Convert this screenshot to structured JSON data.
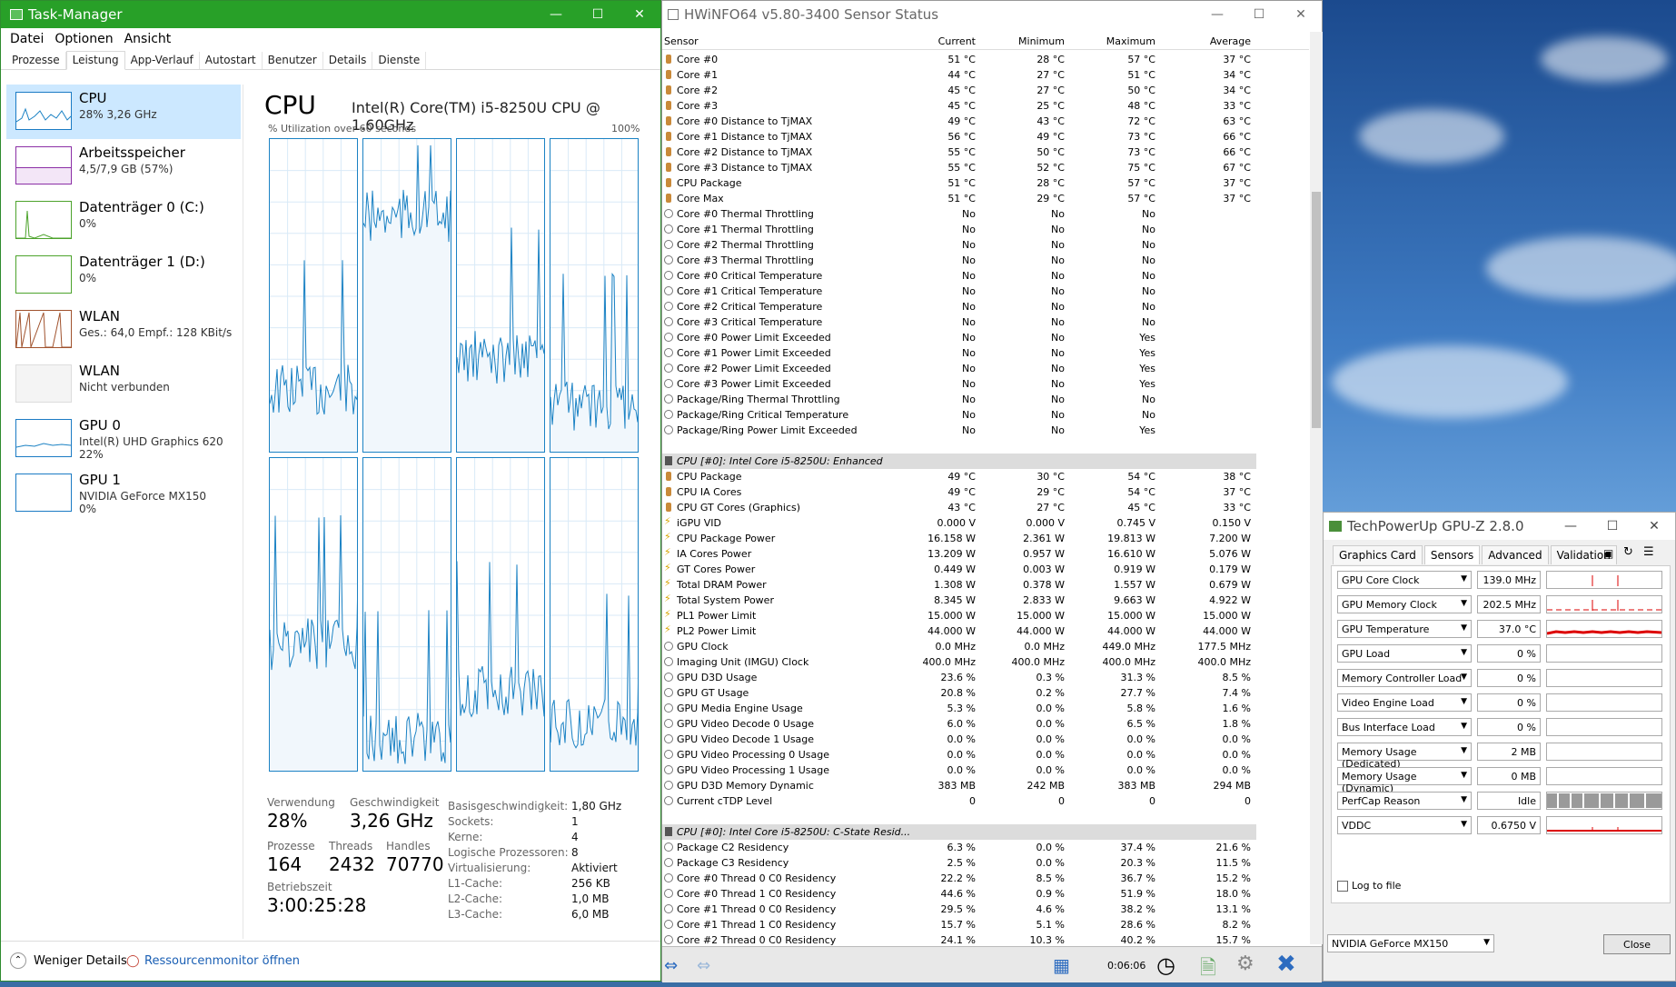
{
  "taskmanager": {
    "title": "Task-Manager",
    "menu": [
      "Datei",
      "Optionen",
      "Ansicht"
    ],
    "tabs": [
      "Prozesse",
      "Leistung",
      "App-Verlauf",
      "Autostart",
      "Benutzer",
      "Details",
      "Dienste"
    ],
    "sidebar": [
      {
        "t1": "CPU",
        "t2": "28% 3,26 GHz",
        "t3": ""
      },
      {
        "t1": "Arbeitsspeicher",
        "t2": "4,5/7,9 GB (57%)",
        "t3": ""
      },
      {
        "t1": "Datenträger 0 (C:)",
        "t2": "0%",
        "t3": ""
      },
      {
        "t1": "Datenträger 1 (D:)",
        "t2": "0%",
        "t3": ""
      },
      {
        "t1": "WLAN",
        "t2": "Ges.: 64,0  Empf.: 128 KBit/s",
        "t3": ""
      },
      {
        "t1": "WLAN",
        "t2": "Nicht verbunden",
        "t3": ""
      },
      {
        "t1": "GPU 0",
        "t2": "Intel(R) UHD Graphics 620",
        "t3": "22%"
      },
      {
        "t1": "GPU 1",
        "t2": "NVIDIA GeForce MX150",
        "t3": "0%"
      }
    ],
    "heading": "CPU",
    "model": "Intel(R) Core(TM) i5-8250U CPU @ 1.60GHz",
    "caption_left": "% Utilization over 60 seconds",
    "caption_right": "100%",
    "stats": {
      "verwendung_label": "Verwendung",
      "verwendung": "28%",
      "geschw_label": "Geschwindigkeit",
      "geschw": "3,26 GHz",
      "prozesse_label": "Prozesse",
      "prozesse": "164",
      "threads_label": "Threads",
      "threads": "2432",
      "handles_label": "Handles",
      "handles": "70770",
      "betrieb_label": "Betriebszeit",
      "betrieb": "3:00:25:28"
    },
    "details": [
      {
        "k": "Basisgeschwindigkeit:",
        "v": "1,80 GHz"
      },
      {
        "k": "Sockets:",
        "v": "1"
      },
      {
        "k": "Kerne:",
        "v": "4"
      },
      {
        "k": "Logische Prozessoren:",
        "v": "8"
      },
      {
        "k": "Virtualisierung:",
        "v": "Aktiviert"
      },
      {
        "k": "L1-Cache:",
        "v": "256 KB"
      },
      {
        "k": "L2-Cache:",
        "v": "1,0 MB"
      },
      {
        "k": "L3-Cache:",
        "v": "6,0 MB"
      }
    ],
    "less_details": "Weniger Details",
    "resmon": "Ressourcenmonitor öffnen"
  },
  "hwinfo": {
    "title": "HWiNFO64 v5.80-3400 Sensor Status",
    "columns": [
      "Sensor",
      "Current",
      "Minimum",
      "Maximum",
      "Average"
    ],
    "rows1": [
      [
        "t",
        "Core #0",
        "51 °C",
        "28 °C",
        "57 °C",
        "37 °C"
      ],
      [
        "t",
        "Core #1",
        "44 °C",
        "27 °C",
        "51 °C",
        "34 °C"
      ],
      [
        "t",
        "Core #2",
        "45 °C",
        "27 °C",
        "50 °C",
        "34 °C"
      ],
      [
        "t",
        "Core #3",
        "45 °C",
        "25 °C",
        "48 °C",
        "33 °C"
      ],
      [
        "t",
        "Core #0 Distance to TjMAX",
        "49 °C",
        "43 °C",
        "72 °C",
        "63 °C"
      ],
      [
        "t",
        "Core #1 Distance to TjMAX",
        "56 °C",
        "49 °C",
        "73 °C",
        "66 °C"
      ],
      [
        "t",
        "Core #2 Distance to TjMAX",
        "55 °C",
        "50 °C",
        "73 °C",
        "66 °C"
      ],
      [
        "t",
        "Core #3 Distance to TjMAX",
        "55 °C",
        "52 °C",
        "75 °C",
        "67 °C"
      ],
      [
        "t",
        "CPU Package",
        "51 °C",
        "28 °C",
        "57 °C",
        "37 °C"
      ],
      [
        "t",
        "Core Max",
        "51 °C",
        "29 °C",
        "57 °C",
        "37 °C"
      ],
      [
        "c",
        "Core #0 Thermal Throttling",
        "No",
        "No",
        "No",
        ""
      ],
      [
        "c",
        "Core #1 Thermal Throttling",
        "No",
        "No",
        "No",
        ""
      ],
      [
        "c",
        "Core #2 Thermal Throttling",
        "No",
        "No",
        "No",
        ""
      ],
      [
        "c",
        "Core #3 Thermal Throttling",
        "No",
        "No",
        "No",
        ""
      ],
      [
        "c",
        "Core #0 Critical Temperature",
        "No",
        "No",
        "No",
        ""
      ],
      [
        "c",
        "Core #1 Critical Temperature",
        "No",
        "No",
        "No",
        ""
      ],
      [
        "c",
        "Core #2 Critical Temperature",
        "No",
        "No",
        "No",
        ""
      ],
      [
        "c",
        "Core #3 Critical Temperature",
        "No",
        "No",
        "No",
        ""
      ],
      [
        "c",
        "Core #0 Power Limit Exceeded",
        "No",
        "No",
        "Yes",
        ""
      ],
      [
        "c",
        "Core #1 Power Limit Exceeded",
        "No",
        "No",
        "Yes",
        ""
      ],
      [
        "c",
        "Core #2 Power Limit Exceeded",
        "No",
        "No",
        "Yes",
        ""
      ],
      [
        "c",
        "Core #3 Power Limit Exceeded",
        "No",
        "No",
        "Yes",
        ""
      ],
      [
        "c",
        "Package/Ring Thermal Throttling",
        "No",
        "No",
        "No",
        ""
      ],
      [
        "c",
        "Package/Ring Critical Temperature",
        "No",
        "No",
        "No",
        ""
      ],
      [
        "c",
        "Package/Ring Power Limit Exceeded",
        "No",
        "No",
        "Yes",
        ""
      ]
    ],
    "group2": "CPU [#0]: Intel Core i5-8250U: Enhanced",
    "rows2": [
      [
        "t",
        "CPU Package",
        "49 °C",
        "30 °C",
        "54 °C",
        "38 °C"
      ],
      [
        "t",
        "CPU IA Cores",
        "49 °C",
        "29 °C",
        "54 °C",
        "37 °C"
      ],
      [
        "t",
        "CPU GT Cores (Graphics)",
        "43 °C",
        "27 °C",
        "45 °C",
        "33 °C"
      ],
      [
        "v",
        "iGPU VID",
        "0.000 V",
        "0.000 V",
        "0.745 V",
        "0.150 V"
      ],
      [
        "v",
        "CPU Package Power",
        "16.158 W",
        "2.361 W",
        "19.813 W",
        "7.200 W"
      ],
      [
        "v",
        "IA Cores Power",
        "13.209 W",
        "0.957 W",
        "16.610 W",
        "5.076 W"
      ],
      [
        "v",
        "GT Cores Power",
        "0.449 W",
        "0.003 W",
        "0.919 W",
        "0.179 W"
      ],
      [
        "v",
        "Total DRAM Power",
        "1.308 W",
        "0.378 W",
        "1.557 W",
        "0.679 W"
      ],
      [
        "v",
        "Total System Power",
        "8.345 W",
        "2.833 W",
        "9.663 W",
        "4.922 W"
      ],
      [
        "v",
        "PL1 Power Limit",
        "15.000 W",
        "15.000 W",
        "15.000 W",
        "15.000 W"
      ],
      [
        "v",
        "PL2 Power Limit",
        "44.000 W",
        "44.000 W",
        "44.000 W",
        "44.000 W"
      ],
      [
        "c",
        "GPU Clock",
        "0.0 MHz",
        "0.0 MHz",
        "449.0 MHz",
        "177.5 MHz"
      ],
      [
        "c",
        "Imaging Unit (IMGU) Clock",
        "400.0 MHz",
        "400.0 MHz",
        "400.0 MHz",
        "400.0 MHz"
      ],
      [
        "c",
        "GPU D3D Usage",
        "23.6 %",
        "0.3 %",
        "31.3 %",
        "8.5 %"
      ],
      [
        "c",
        "GPU GT Usage",
        "20.8 %",
        "0.2 %",
        "27.7 %",
        "7.4 %"
      ],
      [
        "c",
        "GPU Media Engine Usage",
        "5.3 %",
        "0.0 %",
        "5.8 %",
        "1.6 %"
      ],
      [
        "c",
        "GPU Video Decode 0 Usage",
        "6.0 %",
        "0.0 %",
        "6.5 %",
        "1.8 %"
      ],
      [
        "c",
        "GPU Video Decode 1 Usage",
        "0.0 %",
        "0.0 %",
        "0.0 %",
        "0.0 %"
      ],
      [
        "c",
        "GPU Video Processing 0 Usage",
        "0.0 %",
        "0.0 %",
        "0.0 %",
        "0.0 %"
      ],
      [
        "c",
        "GPU Video Processing 1 Usage",
        "0.0 %",
        "0.0 %",
        "0.0 %",
        "0.0 %"
      ],
      [
        "c",
        "GPU D3D Memory Dynamic",
        "383 MB",
        "242 MB",
        "383 MB",
        "294 MB"
      ],
      [
        "c",
        "Current cTDP Level",
        "0",
        "0",
        "0",
        "0"
      ]
    ],
    "group3": "CPU [#0]: Intel Core i5-8250U: C-State Resid...",
    "rows3": [
      [
        "c",
        "Package C2 Residency",
        "6.3 %",
        "0.0 %",
        "37.4 %",
        "21.6 %"
      ],
      [
        "c",
        "Package C3 Residency",
        "2.5 %",
        "0.0 %",
        "20.3 %",
        "11.5 %"
      ],
      [
        "c",
        "Core #0 Thread 0 C0 Residency",
        "22.2 %",
        "8.5 %",
        "36.7 %",
        "15.2 %"
      ],
      [
        "c",
        "Core #0 Thread 1 C0 Residency",
        "44.6 %",
        "0.9 %",
        "51.9 %",
        "18.0 %"
      ],
      [
        "c",
        "Core #1 Thread 0 C0 Residency",
        "29.5 %",
        "4.6 %",
        "38.2 %",
        "13.1 %"
      ],
      [
        "c",
        "Core #1 Thread 1 C0 Residency",
        "15.7 %",
        "5.1 %",
        "28.6 %",
        "8.2 %"
      ],
      [
        "c",
        "Core #2 Thread 0 C0 Residency",
        "24.1 %",
        "10.3 %",
        "40.2 %",
        "15.7 %"
      ]
    ],
    "timer": "0:06:06"
  },
  "gpuz": {
    "title": "TechPowerUp GPU-Z 2.8.0",
    "tabs": [
      "Graphics Card",
      "Sensors",
      "Advanced",
      "Validation"
    ],
    "sensors": [
      {
        "label": "GPU Core Clock",
        "value": "139.0 MHz"
      },
      {
        "label": "GPU Memory Clock",
        "value": "202.5 MHz"
      },
      {
        "label": "GPU Temperature",
        "value": "37.0 °C"
      },
      {
        "label": "GPU Load",
        "value": "0 %"
      },
      {
        "label": "Memory Controller Load",
        "value": "0 %"
      },
      {
        "label": "Video Engine Load",
        "value": "0 %"
      },
      {
        "label": "Bus Interface Load",
        "value": "0 %"
      },
      {
        "label": "Memory Usage (Dedicated)",
        "value": "2 MB"
      },
      {
        "label": "Memory Usage (Dynamic)",
        "value": "0 MB"
      },
      {
        "label": "PerfCap Reason",
        "value": "Idle"
      },
      {
        "label": "VDDC",
        "value": "0.6750 V"
      }
    ],
    "log": "Log to file",
    "device": "NVIDIA GeForce MX150",
    "close": "Close"
  }
}
